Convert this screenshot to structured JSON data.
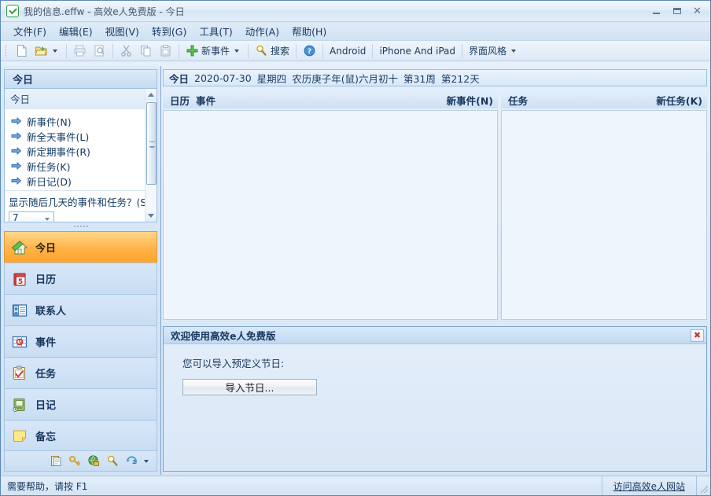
{
  "window": {
    "title": "我的信息.effw - 高效e人免费版 - 今日",
    "app_icon": "checkmark-icon",
    "minimize": "–",
    "maximize": "□",
    "close": "✕"
  },
  "menubar": {
    "items": [
      {
        "label": "文件(F)"
      },
      {
        "label": "编辑(E)"
      },
      {
        "label": "视图(V)"
      },
      {
        "label": "转到(G)"
      },
      {
        "label": "工具(T)"
      },
      {
        "label": "动作(A)"
      },
      {
        "label": "帮助(H)"
      }
    ]
  },
  "toolbar": {
    "new_file": "new-file-icon",
    "open_file": "open-folder-icon",
    "print": "print-icon",
    "print_preview": "print-preview-icon",
    "cut": "scissors-icon",
    "copy": "copy-icon",
    "paste": "paste-icon",
    "new_event_label": "新事件",
    "search_label": "搜索",
    "help_icon": "help-icon",
    "android_label": "Android",
    "iphone_label": "iPhone And iPad",
    "skin_label": "界面风格"
  },
  "sidebar": {
    "header": "今日",
    "panel": {
      "title": "今日",
      "links": [
        {
          "label": "新事件(N)"
        },
        {
          "label": "新全天事件(L)"
        },
        {
          "label": "新定期事件(R)"
        },
        {
          "label": "新任务(K)"
        },
        {
          "label": "新日记(D)"
        }
      ],
      "footer_label": "显示随后几天的事件和任务？(S)",
      "days_value": "7"
    },
    "nav": [
      {
        "label": "今日",
        "icon": "home-icon",
        "active": true
      },
      {
        "label": "日历",
        "icon": "calendar-icon",
        "active": false
      },
      {
        "label": "联系人",
        "icon": "contacts-icon",
        "active": false
      },
      {
        "label": "事件",
        "icon": "event-grid-icon",
        "active": false
      },
      {
        "label": "任务",
        "icon": "task-clipboard-icon",
        "active": false
      },
      {
        "label": "日记",
        "icon": "diary-icon",
        "active": false
      },
      {
        "label": "备忘",
        "icon": "note-icon",
        "active": false
      }
    ],
    "bottom_icons": [
      {
        "name": "clipboard-icon"
      },
      {
        "name": "key-icon"
      },
      {
        "name": "globe-lock-icon"
      },
      {
        "name": "magnifier-icon"
      },
      {
        "name": "sync-icon"
      },
      {
        "name": "chevron-down-icon"
      }
    ]
  },
  "main": {
    "date_bar": {
      "today_label": "今日",
      "date": "2020-07-30",
      "weekday": "星期四",
      "lunar": "农历庚子年(鼠)六月初十",
      "week": "第31周",
      "day_of_year": "第212天"
    },
    "calendar_pane": {
      "tab_calendar": "日历",
      "tab_event": "事件",
      "action": "新事件(N)"
    },
    "task_pane": {
      "title": "任务",
      "action": "新任务(K)"
    },
    "welcome": {
      "title": "欢迎使用高效e人免费版",
      "close_icon": "close-icon",
      "text": "您可以导入预定义节日:",
      "import_button": "导入节日..."
    }
  },
  "statusbar": {
    "hint": "需要帮助，请按 F1",
    "link": "访问高效e人网站"
  }
}
